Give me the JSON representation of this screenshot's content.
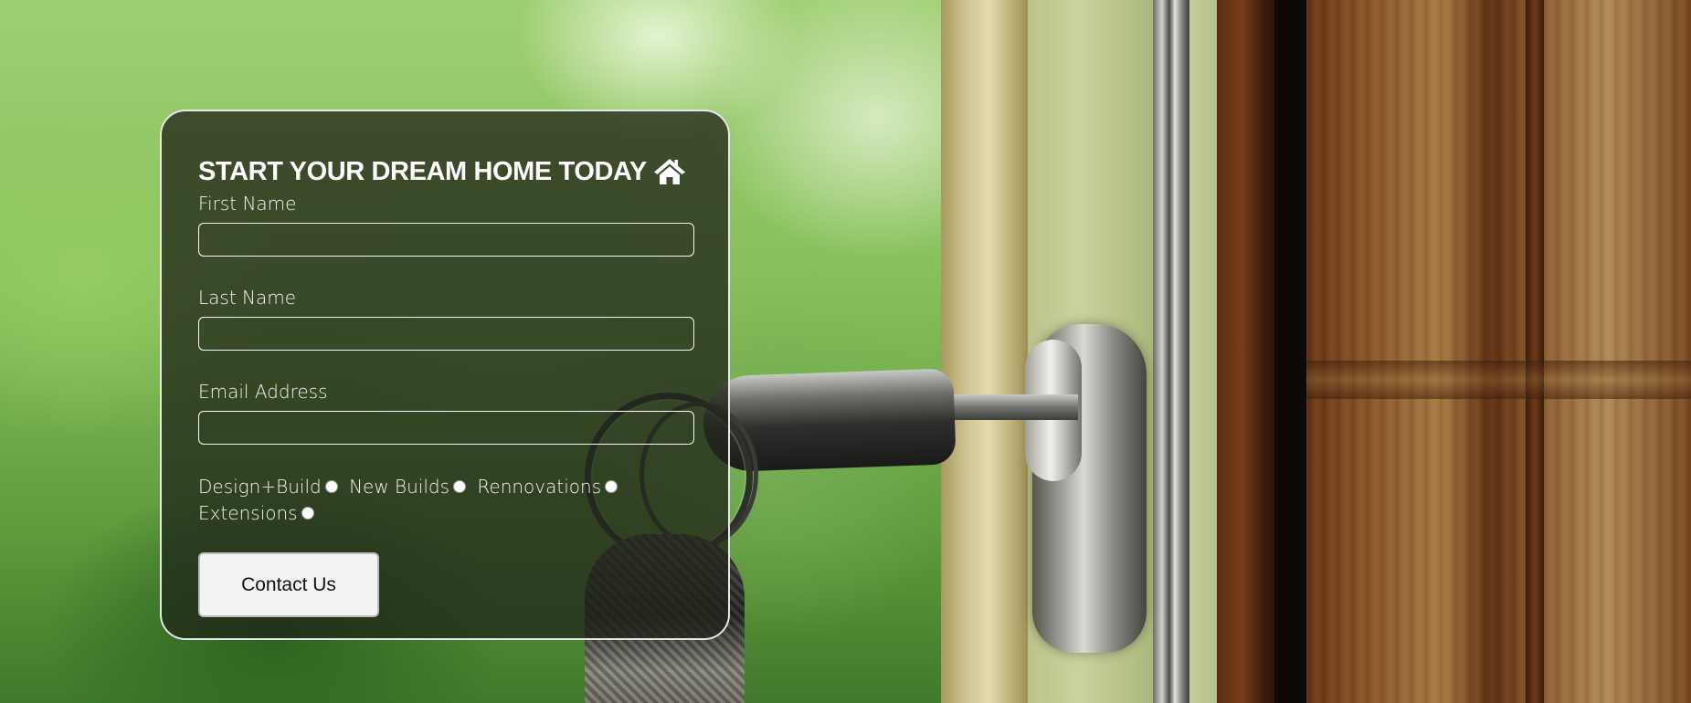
{
  "form": {
    "title": "START YOUR DREAM HOME TODAY",
    "title_icon": "home-icon",
    "fields": [
      {
        "label": "First Name",
        "value": "",
        "placeholder": ""
      },
      {
        "label": "Last Name",
        "value": "",
        "placeholder": ""
      },
      {
        "label": "Email Address",
        "value": "",
        "placeholder": ""
      }
    ],
    "options": [
      {
        "label": "Design+Build",
        "checked": false
      },
      {
        "label": "New Builds",
        "checked": false
      },
      {
        "label": "Rennovations",
        "checked": false
      },
      {
        "label": "Extensions",
        "checked": false
      }
    ],
    "submit_label": "Contact Us"
  },
  "colors": {
    "card_background": "#212519",
    "card_border": "#e6e6e6",
    "text": "#ffffff",
    "button_background": "#f3f3f3"
  },
  "background_image": "photo of a key in a door lock with a blurred green garden background"
}
